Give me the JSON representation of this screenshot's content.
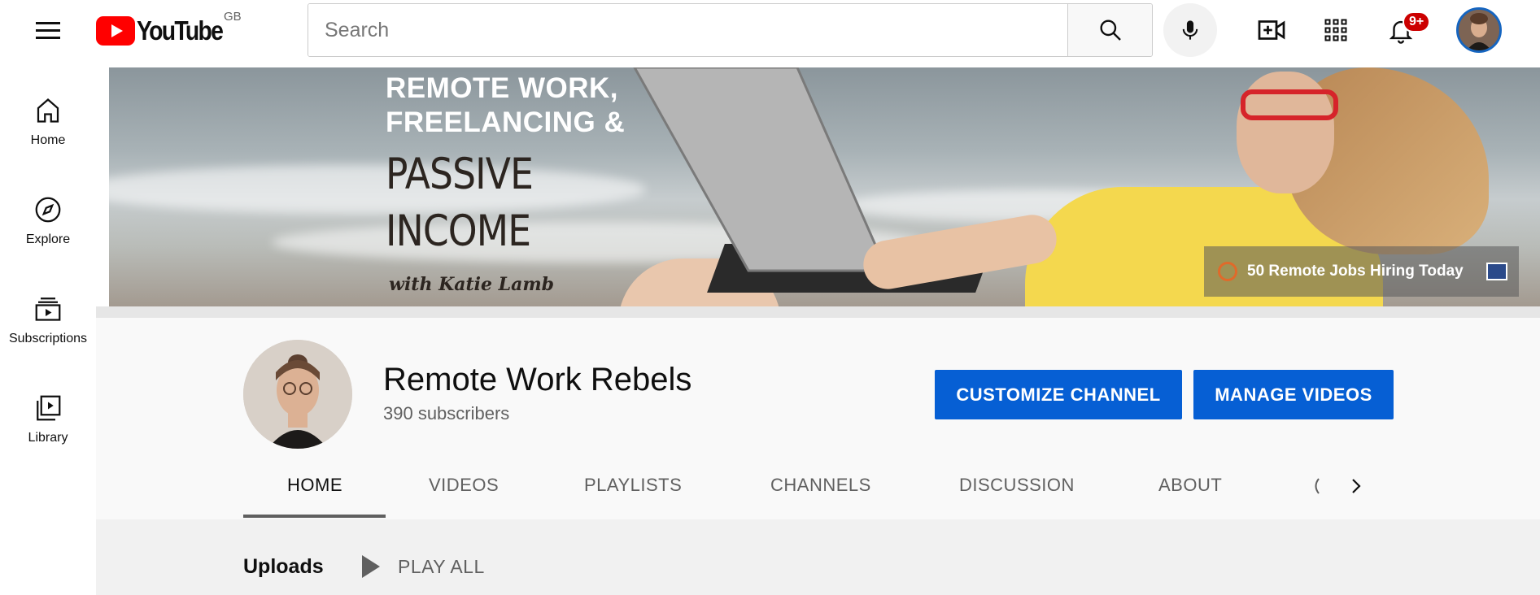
{
  "header": {
    "logo_text": "YouTube",
    "region": "GB",
    "search_placeholder": "Search",
    "notification_count": "9+"
  },
  "sidebar": {
    "items": [
      {
        "label": "Home",
        "icon": "home-icon"
      },
      {
        "label": "Explore",
        "icon": "compass-icon"
      },
      {
        "label": "Subscriptions",
        "icon": "subscriptions-icon"
      },
      {
        "label": "Library",
        "icon": "library-icon"
      }
    ]
  },
  "banner": {
    "line1a": "REMOTE WORK,",
    "line1b": "FREELANCING &",
    "line2a": "PASSIVE",
    "line2b": "INCOME",
    "line3": "with Katie Lamb",
    "link_text": "50 Remote Jobs Hiring Today"
  },
  "channel": {
    "name": "Remote Work Rebels",
    "subscribers": "390 subscribers",
    "customize_label": "CUSTOMIZE CHANNEL",
    "manage_label": "MANAGE VIDEOS"
  },
  "tabs": [
    {
      "label": "HOME",
      "active": true
    },
    {
      "label": "VIDEOS"
    },
    {
      "label": "PLAYLISTS"
    },
    {
      "label": "CHANNELS"
    },
    {
      "label": "DISCUSSION"
    },
    {
      "label": "ABOUT"
    }
  ],
  "uploads": {
    "title": "Uploads",
    "play_all": "PLAY ALL"
  },
  "colors": {
    "brand_red": "#ff0000",
    "primary_blue": "#065fd4",
    "badge_red": "#cc0000"
  }
}
